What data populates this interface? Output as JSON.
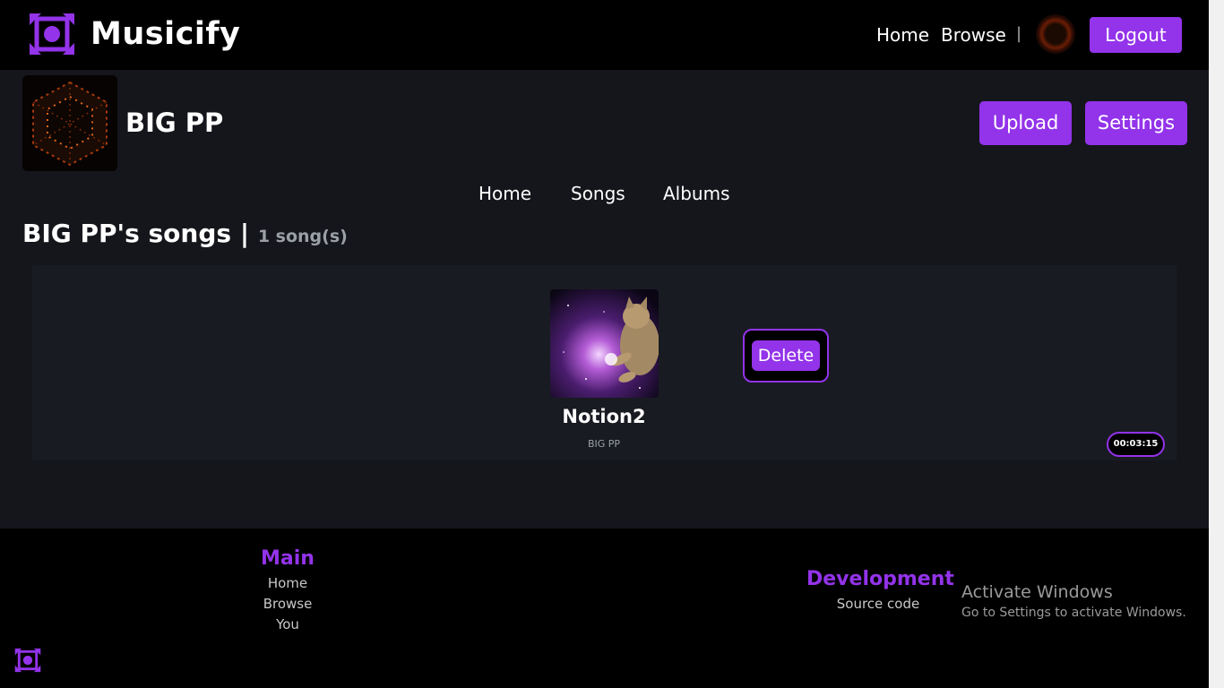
{
  "app": {
    "name": "Musicify",
    "accent": "#9333ea"
  },
  "topnav": {
    "home": "Home",
    "browse": "Browse",
    "separator": "|",
    "logout": "Logout"
  },
  "profile": {
    "name": "BIG PP",
    "upload_label": "Upload",
    "settings_label": "Settings"
  },
  "subnav": {
    "home": "Home",
    "songs": "Songs",
    "albums": "Albums"
  },
  "songs_section": {
    "title": "BIG PP's songs",
    "separator": "|",
    "count": "1 song(s)"
  },
  "songs": [
    {
      "title": "Notion2",
      "artist": "BIG PP",
      "delete_label": "Delete",
      "duration": "00:03:15"
    }
  ],
  "footer": {
    "main": {
      "heading": "Main",
      "links": [
        "Home",
        "Browse",
        "You"
      ]
    },
    "development": {
      "heading": "Development",
      "links": [
        "Source code"
      ]
    }
  },
  "watermark": {
    "title": "Activate Windows",
    "subtitle": "Go to Settings to activate Windows."
  }
}
